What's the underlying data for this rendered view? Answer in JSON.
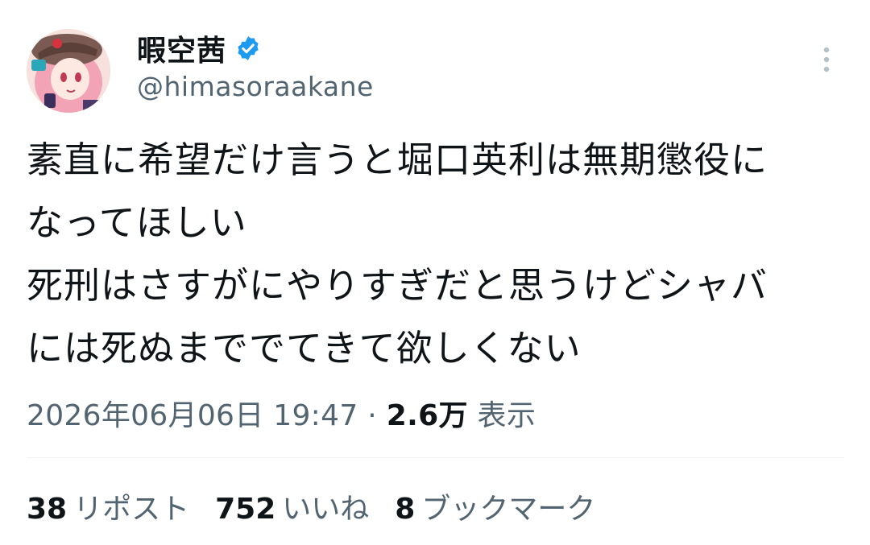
{
  "author": {
    "display_name": "暇空茜",
    "handle": "@himasoraakane",
    "verified_icon": "verified-badge-icon"
  },
  "menu_icon": "more-vertical-icon",
  "tweet": {
    "lines": [
      "素直に希望だけ言うと堀口英利は無期懲役に",
      "なってほしい",
      "死刑はさすがにやりすぎだと思うけどシャバ",
      "には死ぬまででてきて欲しくない"
    ],
    "timestamp": "2026年06月06日 19:47",
    "separator": "·",
    "views_count": "2.6万",
    "views_label": "表示"
  },
  "stats": {
    "reposts": {
      "count": "38",
      "label": "リポスト"
    },
    "likes": {
      "count": "752",
      "label": "いいね"
    },
    "bookmarks": {
      "count": "8",
      "label": "ブックマーク"
    }
  },
  "colors": {
    "text_primary": "#0f1419",
    "text_secondary": "#536471",
    "verified": "#1d9bf0",
    "divider": "#eff3f4"
  }
}
